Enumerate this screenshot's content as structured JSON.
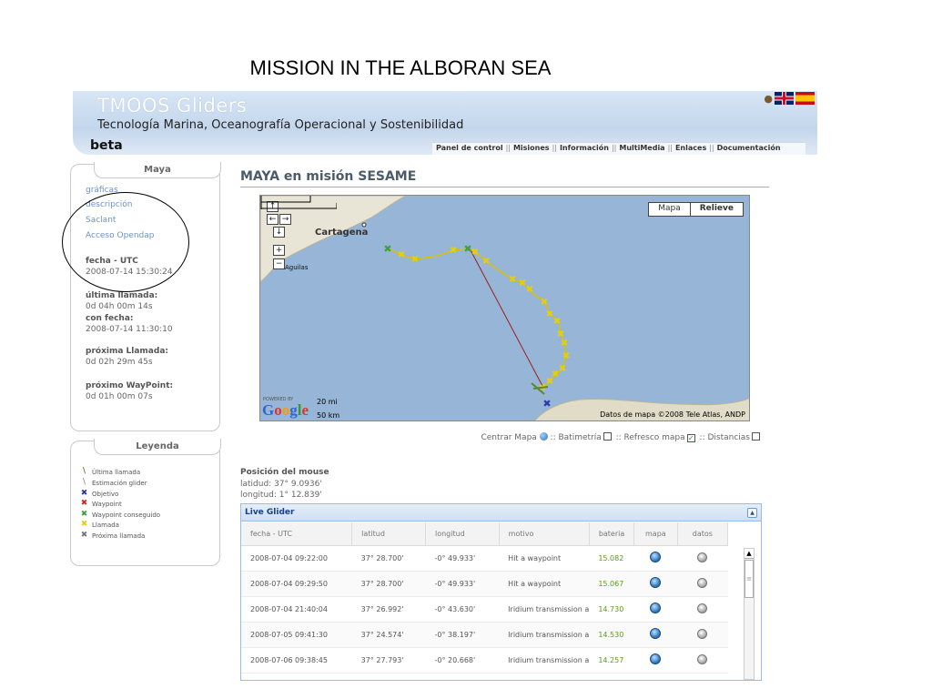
{
  "slide_title": "MISSION IN THE ALBORAN SEA",
  "header": {
    "title": "TMOOS Gliders",
    "subtitle": "Tecnología Marina, Oceanografía Operacional y Sostenibilidad",
    "badge": "beta",
    "nav": [
      "Panel de control",
      "Misiones",
      "Información",
      "MultiMedia",
      "Enlaces",
      "Documentación"
    ]
  },
  "sidebar": {
    "heading": "Maya",
    "links": [
      "gráficas",
      "descripción",
      "Saclant",
      "Acceso Opendap"
    ],
    "fecha_label": "fecha - UTC",
    "fecha_value": "2008-07-14 15:30:24",
    "ultima_label": "última llamada:",
    "ultima_value": "0d 04h 00m 14s",
    "confecha_label": "con fecha:",
    "confecha_value": "2008-07-14 11:30:10",
    "proxima_label": "próxima Llamada:",
    "proxima_value": "0d 02h 29m 45s",
    "waypoint_label": "próximo WayPoint:",
    "waypoint_value": "0d 01h 00m 07s"
  },
  "legend": {
    "heading": "Leyenda",
    "items": [
      "Última llamada",
      "Estimación glider",
      "Objetivo",
      "Waypoint",
      "Waypoint conseguido",
      "Llamada",
      "Próxima llamada"
    ]
  },
  "main": {
    "title": "MAYA en misión SESAME"
  },
  "map": {
    "type_buttons": [
      "Mapa",
      "Relieve"
    ],
    "city_cartagena": "Cartagena",
    "city_aguilas": "Aguilas",
    "powered": "POWERED BY",
    "logo": [
      "G",
      "o",
      "o",
      "g",
      "l",
      "e"
    ],
    "scale_mi": "20 mi",
    "scale_km": "50 km",
    "copyright": "Datos de mapa ©2008 Tele Atlas, ANDP"
  },
  "map_controls": {
    "centrar": "Centrar Mapa",
    "batimetria": ":: Batimetría",
    "refresco": ":: Refresco mapa",
    "distancias": ":: Distancias",
    "refresco_checked": true
  },
  "mouse": {
    "title": "Posición del mouse",
    "lat": "latidud: 37° 9.0936'",
    "lon": "longitud: 1° 12.839'"
  },
  "live_glider": {
    "title": "Live Glider",
    "columns": [
      "fecha - UTC",
      "latitud",
      "longitud",
      "motivo",
      "bateria",
      "mapa",
      "datos"
    ],
    "rows": [
      [
        "2008-07-04 09:22:00",
        "37° 28.700'",
        "-0° 49.933'",
        "Hit a waypoint",
        "15.082"
      ],
      [
        "2008-07-04 09:29:50",
        "37° 28.700'",
        "-0° 49.933'",
        "Hit a waypoint",
        "15.067"
      ],
      [
        "2008-07-04 21:40:04",
        "37° 26.992'",
        "-0° 43.630'",
        "Iridium transmission a",
        "14.730"
      ],
      [
        "2008-07-05 09:41:30",
        "37° 24.574'",
        "-0° 38.197'",
        "Iridium transmission a",
        "14.530"
      ],
      [
        "2008-07-06 09:38:45",
        "37° 27.793'",
        "-0° 20.668'",
        "Iridium transmission a",
        "14.257"
      ]
    ]
  },
  "colors": {
    "sea": "#97b5d6",
    "land": "#e8e4d6",
    "track": "#e8d000",
    "waypoint_reached": "#3ea03e",
    "target": "#2a3aa8",
    "link": "#6b93c4"
  }
}
